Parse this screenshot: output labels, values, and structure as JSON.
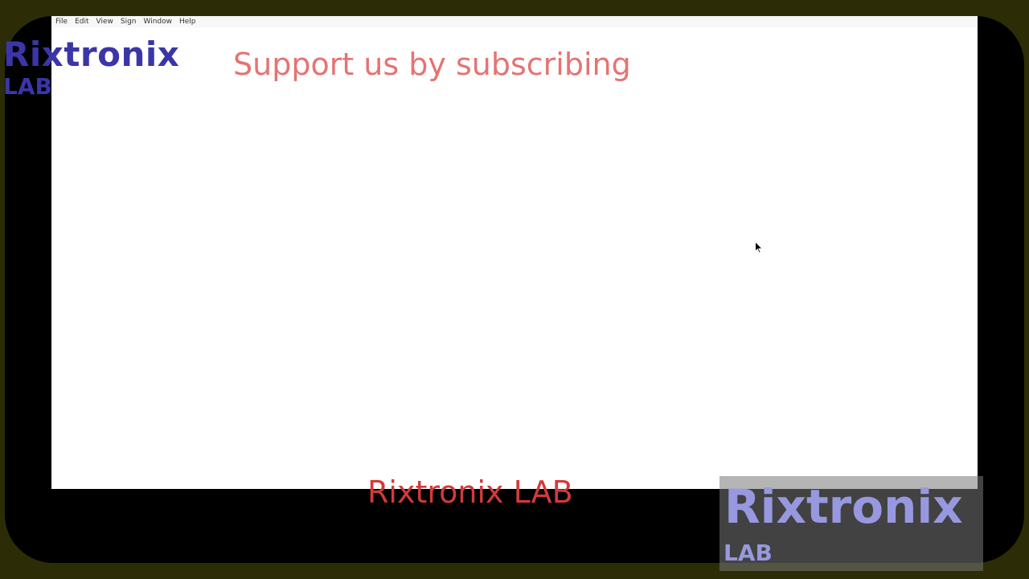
{
  "menu": {
    "items": [
      "File",
      "Edit",
      "View",
      "Sign",
      "Window",
      "Help"
    ]
  },
  "overlay": {
    "logo_main": "Rixtronix",
    "logo_sub": "LAB",
    "support_text": "Support us by subscribing",
    "bottom_text": "Rixtronix LAB",
    "watermark_main": "Rixtronix",
    "watermark_sub": "LAB"
  },
  "colors": {
    "logo": "#3b36a8",
    "support_text": "#e57373",
    "bottom_text": "#d23a3a",
    "watermark": "#9898e0",
    "outer_background": "#2c2c06",
    "bezel": "#000000"
  },
  "icons": {
    "cursor": "mouse-pointer-icon"
  }
}
